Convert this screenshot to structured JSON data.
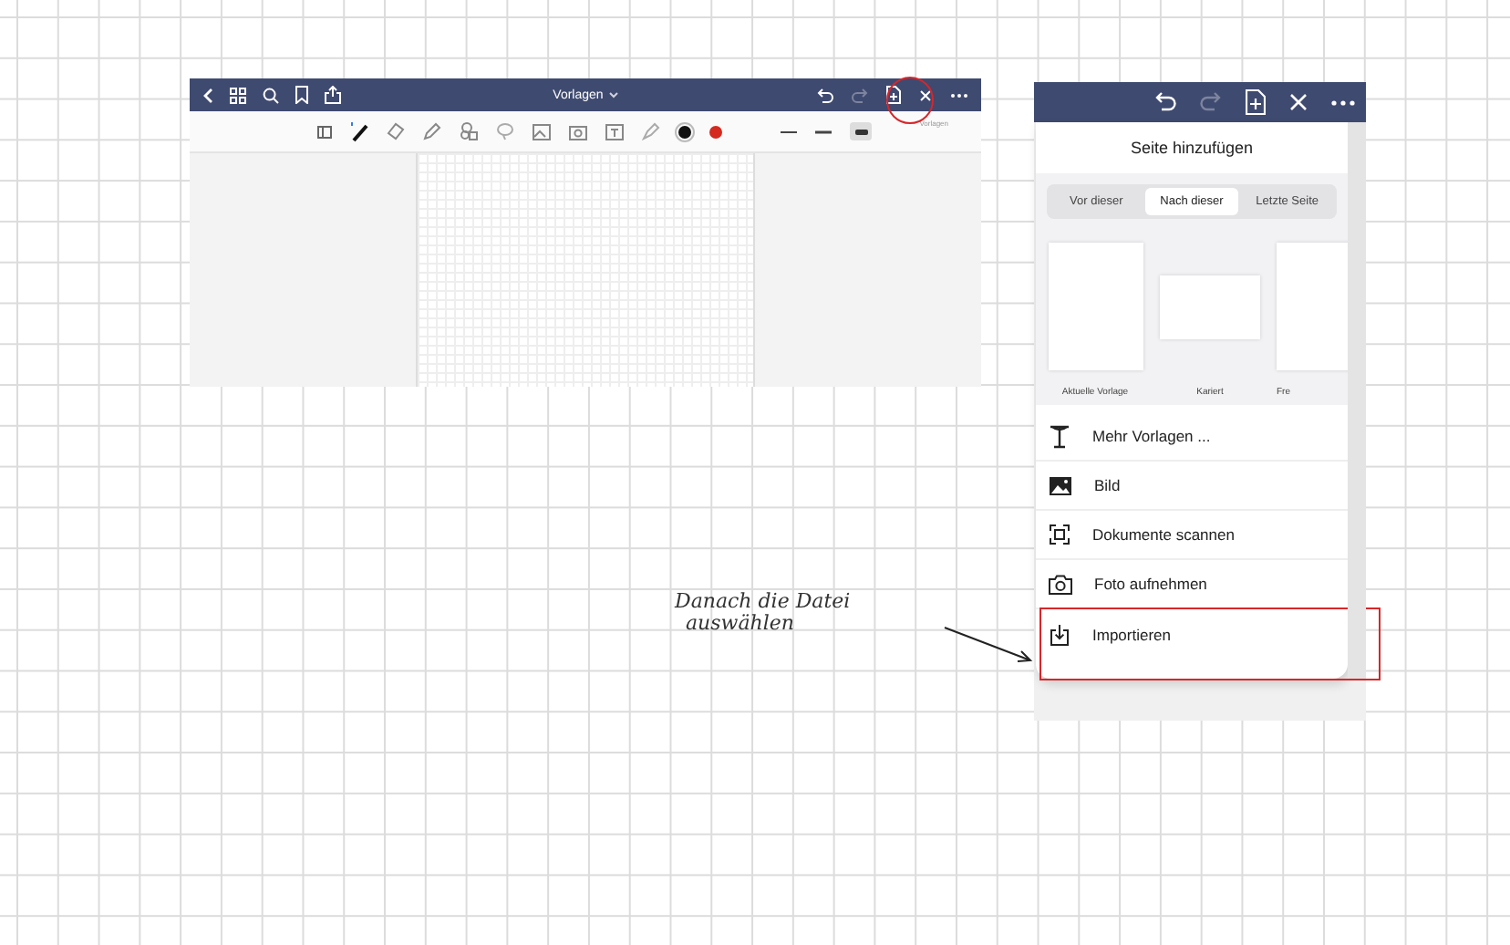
{
  "app_screenshot": {
    "title": "Vorlagen",
    "add_page_circled": true,
    "hint": "Vorlagen",
    "pen_colors": [
      {
        "color": "#111111",
        "selected": true
      },
      {
        "color": "#d42a20",
        "selected": false
      }
    ]
  },
  "add_page_popover": {
    "title": "Seite hinzufügen",
    "positions": [
      {
        "label": "Vor dieser",
        "selected": false
      },
      {
        "label": "Nach dieser",
        "selected": true
      },
      {
        "label": "Letzte Seite",
        "selected": false
      }
    ],
    "templates": [
      {
        "label": "Aktuelle Vorlage",
        "kind": "portrait"
      },
      {
        "label": "Kariert",
        "kind": "landscape"
      },
      {
        "label": "Fre",
        "kind": "portrait"
      }
    ],
    "items": [
      {
        "label": "Mehr Vorlagen ...",
        "kind": "templates",
        "highlighted": false
      },
      {
        "label": "Bild",
        "kind": "image",
        "highlighted": false
      },
      {
        "label": "Dokumente scannen",
        "kind": "scan",
        "highlighted": false
      },
      {
        "label": "Foto aufnehmen",
        "kind": "camera",
        "highlighted": false
      },
      {
        "label": "Importieren",
        "kind": "import",
        "highlighted": true
      }
    ]
  },
  "annotation": {
    "lines": [
      "Danach die Datei",
      "auswählen"
    ]
  }
}
